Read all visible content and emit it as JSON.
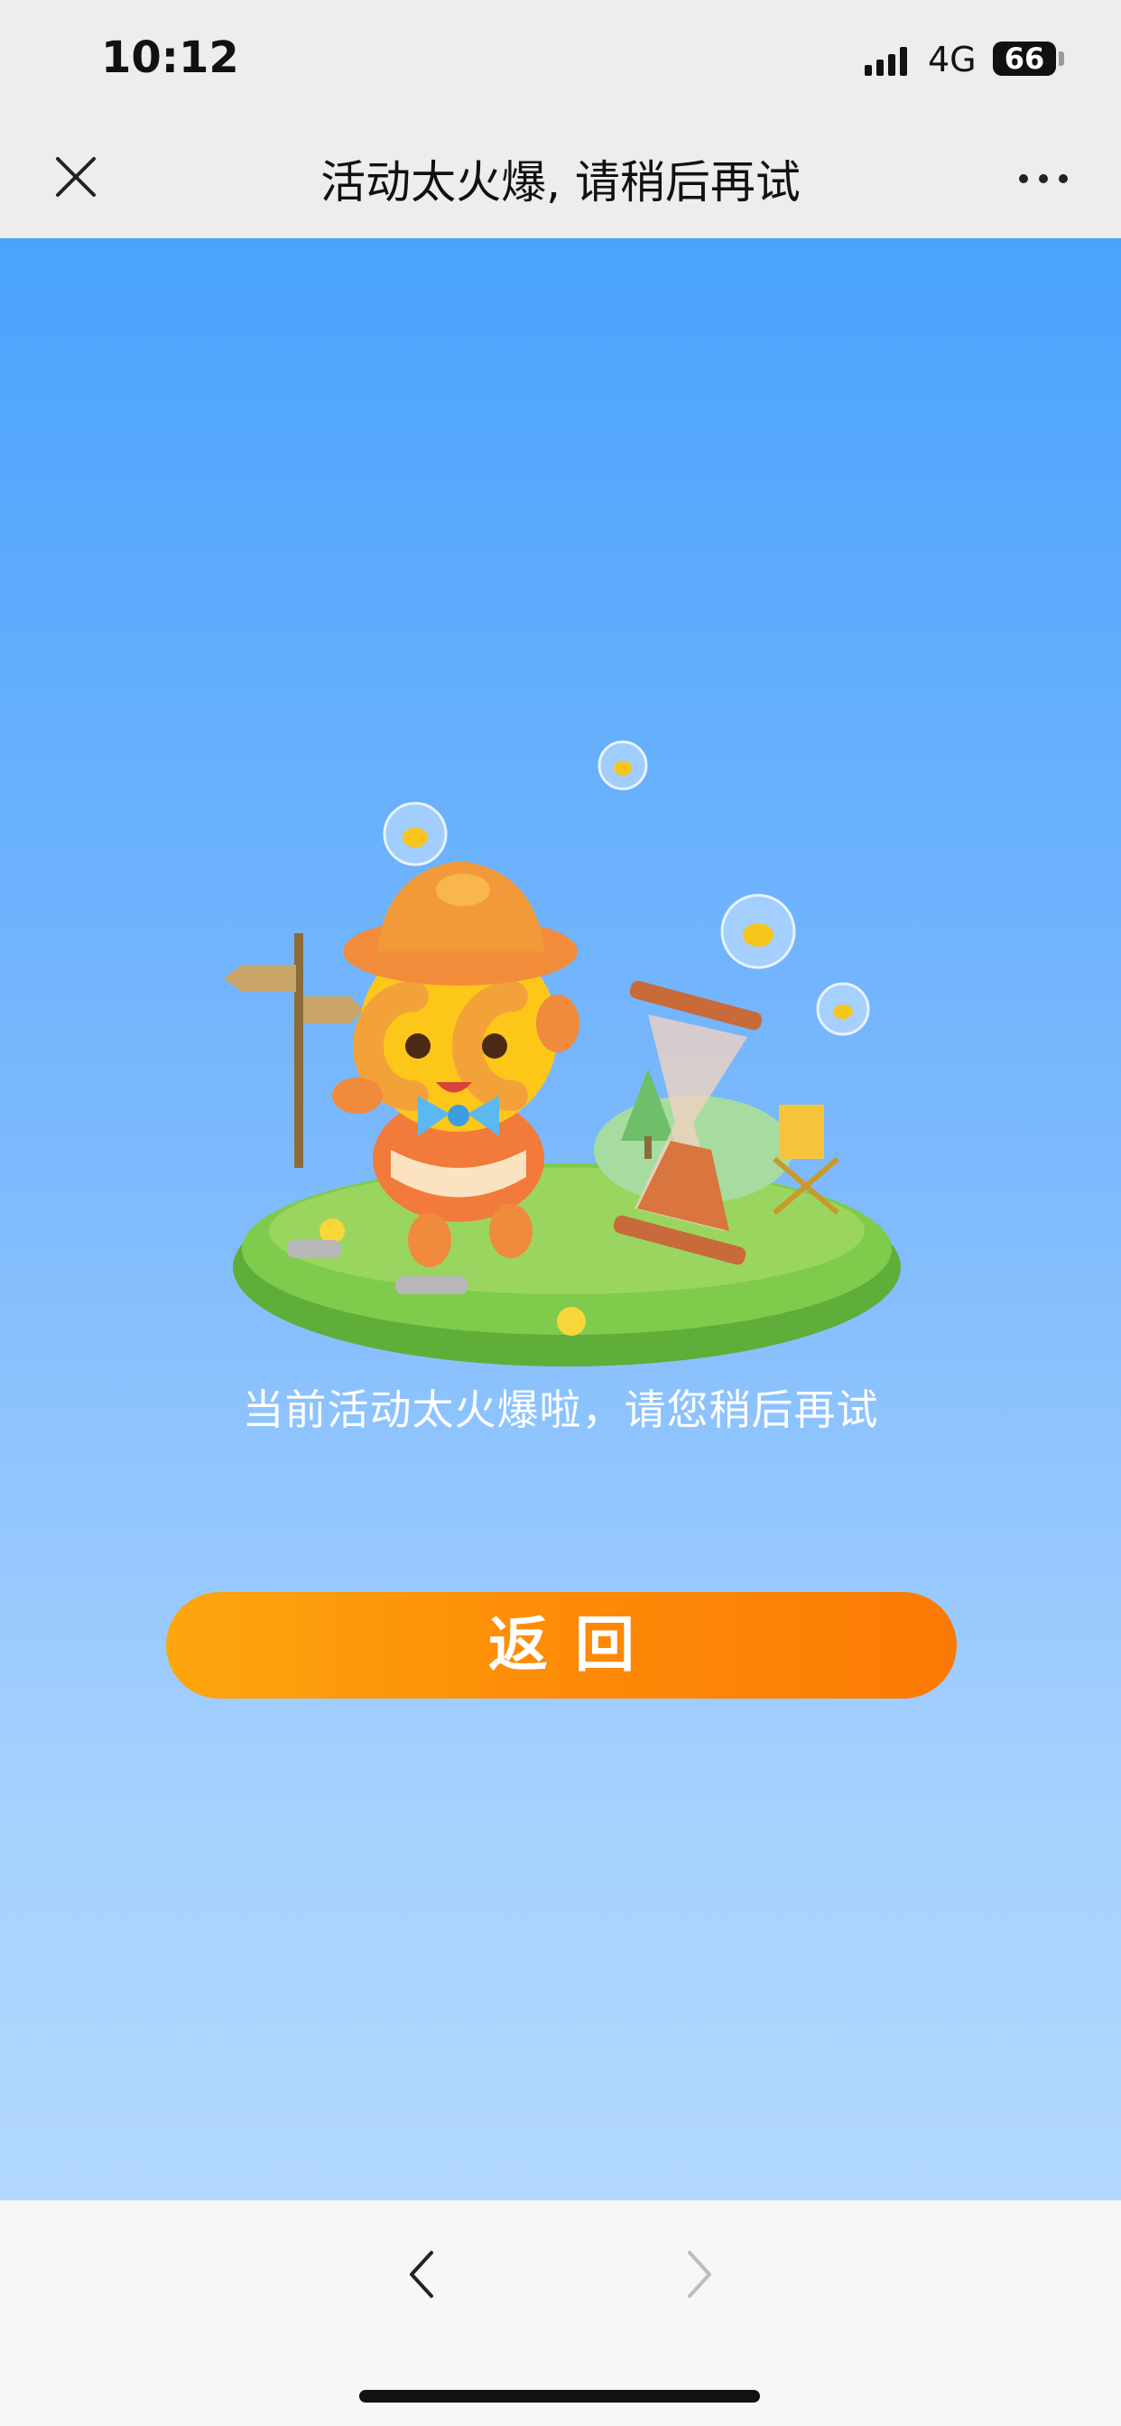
{
  "status_bar": {
    "time": "10:12",
    "network": "4G",
    "battery": "66",
    "icons": [
      "signal-icon",
      "battery-icon"
    ]
  },
  "nav": {
    "title": "活动太火爆, 请稍后再试",
    "icons": [
      "close-icon",
      "more-icon"
    ]
  },
  "content": {
    "message": "当前活动太火爆啦，请您稍后再试",
    "return_button": "返回",
    "illustration": "mascot-hourglass-illustration"
  },
  "bottom_bar": {
    "icons": [
      "back-arrow-icon",
      "forward-arrow-icon"
    ],
    "back_enabled": true,
    "forward_enabled": false
  },
  "colors": {
    "background_top": "#4aa3fd",
    "background_bottom": "#b2d8ff",
    "button_start": "#fda60e",
    "button_end": "#fb7a05",
    "bar_background": "#ededed"
  }
}
